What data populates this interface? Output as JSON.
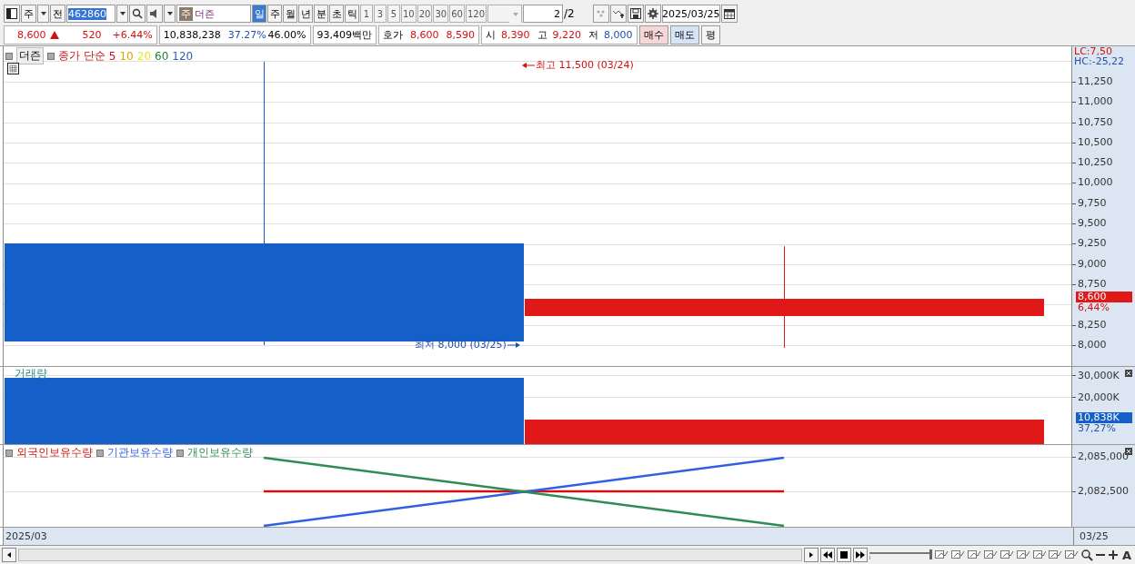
{
  "toolbar": {
    "market": "주",
    "prev": "전",
    "code": "462860",
    "name_badge": "주",
    "name": "더즌",
    "periods": [
      {
        "label": "일",
        "selected": true
      },
      {
        "label": "주",
        "selected": false
      },
      {
        "label": "월",
        "selected": false
      },
      {
        "label": "년",
        "selected": false
      },
      {
        "label": "분",
        "selected": false
      },
      {
        "label": "초",
        "selected": false
      },
      {
        "label": "틱",
        "selected": false
      }
    ],
    "intervals": [
      "1",
      "3",
      "5",
      "10",
      "20",
      "30",
      "60",
      "120"
    ],
    "page": "2",
    "page_total": "/2",
    "date": "2025/03/25"
  },
  "quote": {
    "price": "8,600",
    "change": "520",
    "change_pct": "+6.44%",
    "volume": "10,838,238",
    "ratio_1": "37.27%",
    "ratio_2": "46.00%",
    "amount": "93,409백만",
    "bid_label": "호가",
    "ask": "8,600",
    "bid": "8,590",
    "ohlc": [
      {
        "label": "시",
        "value": "8,390",
        "color": "#d01010"
      },
      {
        "label": "고",
        "value": "9,220",
        "color": "#d01010"
      },
      {
        "label": "저",
        "value": "8,000",
        "color": "#2050b0"
      }
    ],
    "buttons": [
      {
        "label": "매수",
        "kind": "buy"
      },
      {
        "label": "매도",
        "kind": "sell"
      },
      {
        "label": "평",
        "kind": "plain"
      }
    ]
  },
  "price_pane": {
    "name_button": "더즌",
    "legend_label": "종가 단순",
    "ma": [
      {
        "label": "5",
        "color": "#d01010"
      },
      {
        "label": "10",
        "color": "#e0a000"
      },
      {
        "label": "20",
        "color": "#e8e820"
      },
      {
        "label": "60",
        "color": "#208040"
      },
      {
        "label": "120",
        "color": "#3060c0"
      }
    ],
    "high_note": "최고 11,500 (03/24)",
    "low_note": "최저 8,000 (03/25)",
    "lc": "LC:7,50",
    "hc": "HC:-25,22",
    "ticks": [
      "11,250",
      "11,000",
      "10,750",
      "10,500",
      "10,250",
      "10,000",
      "9,750",
      "9,500",
      "9,250",
      "9,000",
      "8,750"
    ],
    "low_ticks": [
      "8,250",
      "8,000"
    ],
    "current": "8,600",
    "current_pct": "6,44%"
  },
  "volume_pane": {
    "title": "거래량",
    "ticks": [
      "30,000K",
      "20,000K"
    ],
    "current": "10,838K",
    "current_pct": "37,27%"
  },
  "holdings_pane": {
    "series": [
      {
        "label": "외국인보유수량",
        "color": "#d01010"
      },
      {
        "label": "기관보유수량",
        "color": "#3060e0"
      },
      {
        "label": "개인보유수량",
        "color": "#2e8b57"
      }
    ],
    "ticks": [
      "2,085,000",
      "2,082,500"
    ]
  },
  "date_axis": {
    "left": "2025/03",
    "right": "03/25"
  },
  "scroll_toolbar": {
    "zoom": {
      "level": 1
    },
    "font_button": "A"
  }
}
